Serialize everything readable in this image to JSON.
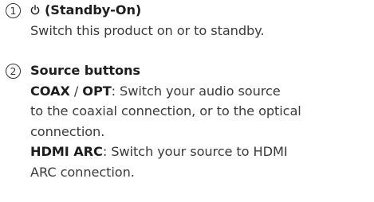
{
  "items": [
    {
      "number": "1",
      "icon": "standby-power-icon",
      "title": "(Standby-On)",
      "description": "Switch this product on or to standby."
    },
    {
      "number": "2",
      "title": "Source buttons",
      "coax_label": "COAX",
      "separator": " / ",
      "opt_label": "OPT",
      "coax_desc_1": ": Switch your audio source",
      "coax_desc_2": "to the coaxial connection, or to the optical",
      "coax_desc_3": "connection.",
      "hdmi_label": "HDMI ARC",
      "hdmi_desc_1": ": Switch your source to HDMI",
      "hdmi_desc_2": "ARC connection."
    }
  ]
}
